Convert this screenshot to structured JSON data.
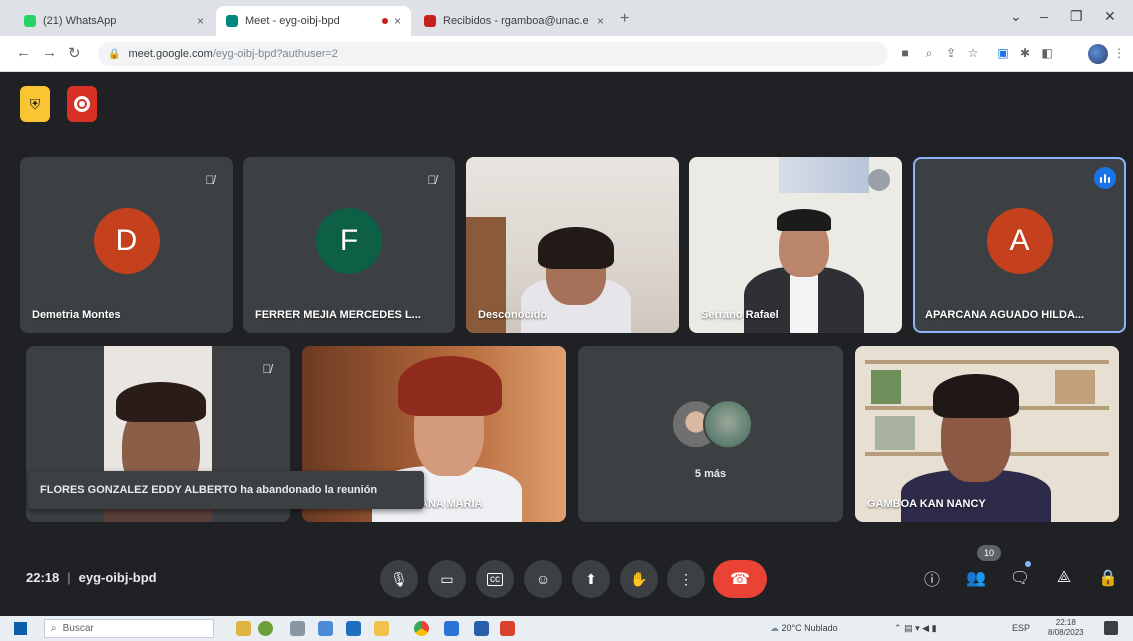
{
  "browser": {
    "tabs": [
      {
        "label": "(21) WhatsApp",
        "favicon_color": "#25d366"
      },
      {
        "label": "Meet - eyg-oibj-bpd",
        "favicon_color": "#00897b"
      },
      {
        "label": "Recibidos - rgamboa@unac.e",
        "favicon_color": "#c5221f"
      }
    ],
    "new_tab": "+",
    "url_host": "meet.google.com",
    "url_path": "/eyg-oibj-bpd?authuser=2"
  },
  "meet": {
    "tiles": [
      {
        "name": "Demetria Montes",
        "initial": "D",
        "avatar_color": "#c5411d",
        "muted": true
      },
      {
        "name": "FERRER MEJIA MERCEDES L...",
        "initial": "F",
        "avatar_color": "#0d5f45",
        "muted": true
      },
      {
        "name": "Desconocido",
        "muted": false
      },
      {
        "name": "Serrano Rafael",
        "muted": false
      },
      {
        "name": "APARCANA AGUADO HILDA...",
        "initial": "A",
        "avatar_color": "#c5411d",
        "speaking": true
      },
      {
        "name": "FLORES GONZALEZ",
        "muted": true
      },
      {
        "name": "ANA MARIA"
      },
      {
        "name": "5 más"
      },
      {
        "name": "GAMBOA KAN NANCY"
      }
    ],
    "toast": "FLORES GONZALEZ EDDY ALBERTO ha abandonado la reunión",
    "time": "22:18",
    "separator": "|",
    "meeting_code": "eyg-oibj-bpd",
    "participant_count": "10"
  },
  "taskbar": {
    "search_placeholder": "Buscar",
    "weather": "20°C Nublado",
    "lang": "ESP",
    "time": "22:18",
    "date": "8/08/2023"
  }
}
